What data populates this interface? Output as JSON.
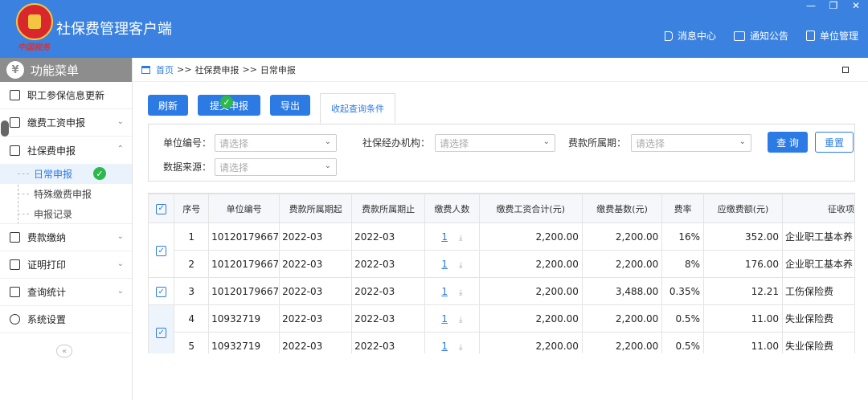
{
  "app": {
    "title": "社保费管理客户端",
    "emblem_sign": "中国税务"
  },
  "window": {
    "min": "—",
    "restore": "❐",
    "close": "✕"
  },
  "topnav": [
    {
      "label": "消息中心",
      "icon": "speaker-icon"
    },
    {
      "label": "通知公告",
      "icon": "mail-icon"
    },
    {
      "label": "单位管理",
      "icon": "building-icon"
    }
  ],
  "sidebar": {
    "header": "功能菜单",
    "header_icon": "¥",
    "items": [
      {
        "label": "职工参保信息更新"
      },
      {
        "label": "缴费工资申报",
        "chev": "⌄"
      },
      {
        "label": "社保费申报",
        "chev": "⌃"
      },
      {
        "label": "费款缴纳",
        "chev": "⌄"
      },
      {
        "label": "证明打印",
        "chev": "⌄"
      },
      {
        "label": "查询统计",
        "chev": "⌄"
      },
      {
        "label": "系统设置"
      }
    ],
    "subitems": [
      "日常申报",
      "特殊缴费申报",
      "申报记录"
    ],
    "collapse": "«"
  },
  "breadcrumb": {
    "home": "首页",
    "sep": ">>",
    "level1": "社保费申报",
    "level2": "日常申报"
  },
  "toolbar": {
    "refresh": "刷新",
    "submit": "提交申报",
    "export": "导出"
  },
  "filter_tab": "收起查询条件",
  "filters": {
    "unit_no_label": "单位编号：",
    "agency_label": "社保经办机构：",
    "period_label": "费款所属期：",
    "source_label": "数据来源：",
    "placeholder": "请选择",
    "query_btn": "查 询",
    "reset_btn": "重置"
  },
  "table": {
    "headers": [
      "序号",
      "单位编号",
      "费款所属期起",
      "费款所属期止",
      "缴费人数",
      "缴费工资合计(元)",
      "缴费基数(元)",
      "费率",
      "应缴费额(元)",
      "征收项"
    ],
    "rows": [
      {
        "no": "1",
        "unit": "10120179667",
        "start": "2022-03",
        "end": "2022-03",
        "count": "1",
        "wage": "2,200.00",
        "base": "2,200.00",
        "rate": "16%",
        "amount": "352.00",
        "item": "企业职工基本养"
      },
      {
        "no": "2",
        "unit": "10120179667",
        "start": "2022-03",
        "end": "2022-03",
        "count": "1",
        "wage": "2,200.00",
        "base": "2,200.00",
        "rate": "8%",
        "amount": "176.00",
        "item": "企业职工基本养"
      },
      {
        "no": "3",
        "unit": "10120179667",
        "start": "2022-03",
        "end": "2022-03",
        "count": "1",
        "wage": "2,200.00",
        "base": "3,488.00",
        "rate": "0.35%",
        "amount": "12.21",
        "item": "工伤保险费"
      },
      {
        "no": "4",
        "unit": "10932719",
        "start": "2022-03",
        "end": "2022-03",
        "count": "1",
        "wage": "2,200.00",
        "base": "2,200.00",
        "rate": "0.5%",
        "amount": "11.00",
        "item": "失业保险费"
      },
      {
        "no": "5",
        "unit": "10932719",
        "start": "2022-03",
        "end": "2022-03",
        "count": "1",
        "wage": "2,200.00",
        "base": "2,200.00",
        "rate": "0.5%",
        "amount": "11.00",
        "item": "失业保险费"
      }
    ]
  },
  "colors": {
    "topbar": "#3b82e0",
    "accent": "#2c7be5",
    "success": "#2db84d"
  }
}
